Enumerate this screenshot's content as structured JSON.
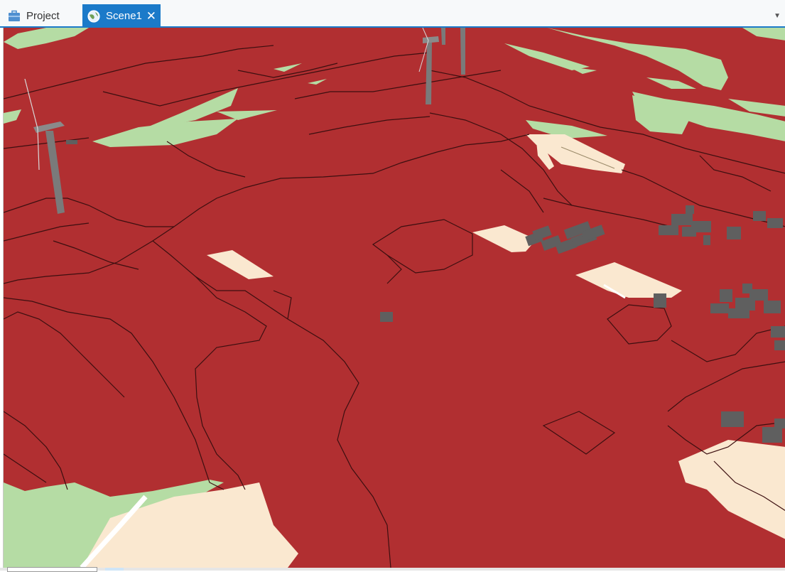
{
  "tabs": {
    "project": {
      "label": "Project",
      "icon": "briefcase-icon"
    },
    "scene": {
      "label": "Scene1",
      "icon": "globe-icon",
      "close_label": "✕",
      "active": true
    },
    "dropdown_icon": "chevron-down-icon"
  },
  "scene": {
    "colors": {
      "terrain": "#b12f31",
      "field": "#fae8d0",
      "grass": "#b5dca4",
      "boundary": "#3c0f10",
      "building": "#5f5f5f",
      "turbine": "#7a7a7a"
    },
    "tool_icon": "list-icon"
  }
}
